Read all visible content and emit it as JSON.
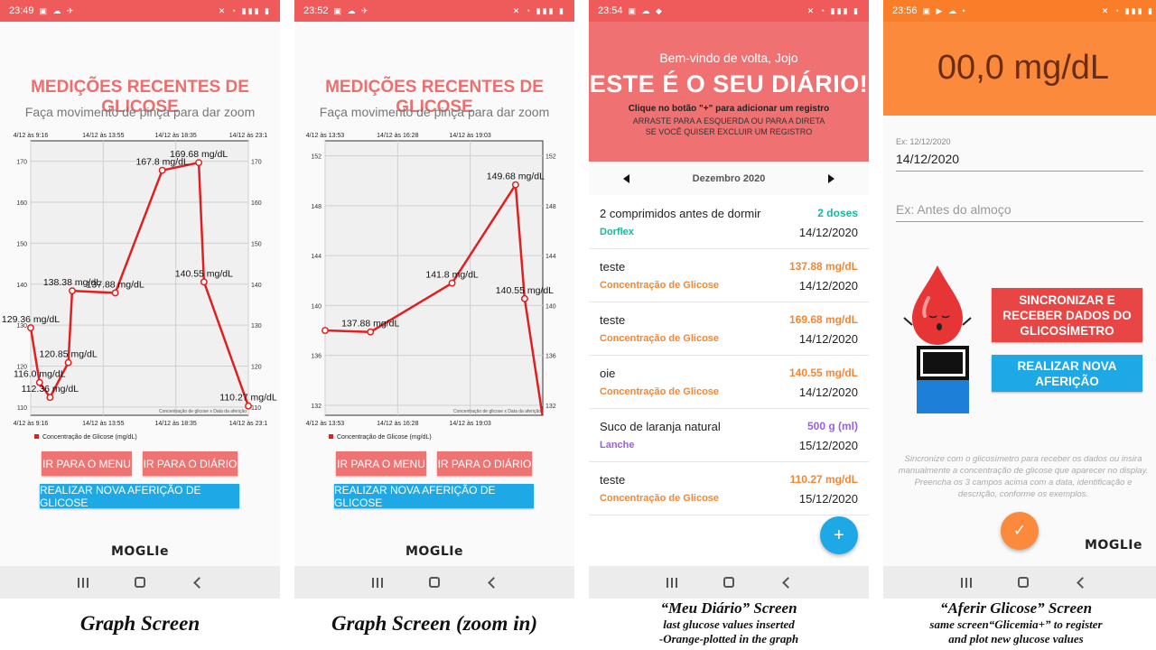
{
  "colors": {
    "red_accent": "#ee6e6e",
    "status_red": "#ef5b5b",
    "status_orange": "#fa7d2a",
    "blue": "#1ea8e6",
    "orange_value": "#f58634",
    "green_dose": "#18b89a",
    "purple": "#9c5fe0"
  },
  "status": {
    "graph1_time": "23:49",
    "graph2_time": "23:52",
    "diary_time": "23:54",
    "aferir_time": "23:56"
  },
  "graph": {
    "title": "MEDIÇÕES RECENTES DE GLICOSE",
    "subtitle": "Faça movimento de pinça para dar zoom",
    "legend": "Concentração de Glicose (mg/dL)",
    "footnote": "Concentração de glicose x Data da aferição",
    "btn_menu": "IR PARA O MENU",
    "btn_diary": "IR PARA O DIÁRIO",
    "btn_new": "REALIZAR NOVA AFERIÇÃO DE GLICOSE",
    "logo": "MOGLIe"
  },
  "chart_data": [
    {
      "type": "line",
      "series": [
        {
          "name": "Concentração de Glicose (mg/dL)",
          "color": "#e02020",
          "points": [
            {
              "x": "14/12 09:16",
              "y": 129.36,
              "label": "129.36 mg/dL"
            },
            {
              "x": "14/12 09:50",
              "y": 116.0,
              "label": "116.0 mg/dL"
            },
            {
              "x": "14/12 10:30",
              "y": 112.36,
              "label": "112.36 mg/dL"
            },
            {
              "x": "14/12 11:40",
              "y": 120.85,
              "label": "120.85 mg/dL"
            },
            {
              "x": "14/12 11:55",
              "y": 138.38,
              "label": "138.38 mg/dL"
            },
            {
              "x": "14/12 14:40",
              "y": 137.88,
              "label": "137.88 mg/dL"
            },
            {
              "x": "14/12 17:40",
              "y": 167.8,
              "label": "167.8 mg/dL"
            },
            {
              "x": "14/12 20:00",
              "y": 169.68,
              "label": "169.68 mg/dL"
            },
            {
              "x": "14/12 20:20",
              "y": 140.55,
              "label": "140.55 mg/dL"
            },
            {
              "x": "14/12 23:10",
              "y": 110.27,
              "label": "110.27 mg/dL"
            }
          ]
        }
      ],
      "x_tick_labels": [
        "4/12 às 9:16",
        "14/12 às 13:55",
        "14/12 às 18:35",
        "14/12 às 23:1"
      ],
      "y_ticks": [
        110,
        120,
        130,
        140,
        150,
        160,
        170
      ],
      "ylim": [
        108,
        175
      ],
      "xlim_minutes": [
        556,
        1390
      ],
      "grid": true,
      "legend_position": "bottom-left"
    },
    {
      "type": "line",
      "series": [
        {
          "name": "Concentração de Glicose (mg/dL)",
          "color": "#e02020",
          "points": [
            {
              "x": "14/12 13:00",
              "y": 138.0,
              "label": ""
            },
            {
              "x": "14/12 14:40",
              "y": 137.88,
              "label": "137.88 mg/dL"
            },
            {
              "x": "14/12 17:40",
              "y": 141.8,
              "label": "141.8 mg/dL"
            },
            {
              "x": "14/12 20:00",
              "y": 149.68,
              "label": "149.68 mg/dL"
            },
            {
              "x": "14/12 20:20",
              "y": 140.55,
              "label": "140.55 mg/dL"
            },
            {
              "x": "14/12 21:00",
              "y": 131.0,
              "label": ""
            }
          ]
        }
      ],
      "x_tick_labels": [
        "4/12 às 13:53",
        "14/12 às 16:28",
        "14/12 às 19:03"
      ],
      "y_ticks": [
        132,
        136,
        140,
        144,
        148,
        152
      ],
      "ylim": [
        131.2,
        153.2
      ],
      "xlim_minutes": [
        780,
        1260
      ],
      "grid": true,
      "legend_position": "bottom-left"
    }
  ],
  "diary": {
    "welcome": "Bem-vindo de volta, Jojo",
    "big_title": "ESTE É O SEU DIÁRIO!",
    "hint": "Clique no botão \"+\" para adicionar um registro",
    "hint2_line1": "ARRASTE PARA A ESQUERDA OU PARA A DIRETA",
    "hint2_line2": "SE VOCÊ QUISER EXCLUIR UM REGISTRO",
    "month": "Dezembro 2020",
    "fab": "+",
    "entries": [
      {
        "title": "2 comprimidos antes de dormir",
        "category": "Dorflex",
        "value": "2 doses",
        "date": "14/12/2020",
        "color": "#18b89a"
      },
      {
        "title": "teste",
        "category": "Concentração de Glicose",
        "value": "137.88 mg/dL",
        "date": "14/12/2020",
        "color": "#f58634"
      },
      {
        "title": "teste",
        "category": "Concentração de Glicose",
        "value": "169.68 mg/dL",
        "date": "14/12/2020",
        "color": "#f58634"
      },
      {
        "title": "oie",
        "category": "Concentração de Glicose",
        "value": "140.55 mg/dL",
        "date": "14/12/2020",
        "color": "#f58634"
      },
      {
        "title": "Suco de laranja natural",
        "category": "Lanche",
        "value": "500 g (ml)",
        "date": "15/12/2020",
        "color": "#9c5fe0"
      },
      {
        "title": "teste",
        "category": "Concentração de Glicose",
        "value": "110.27 mg/dL",
        "date": "15/12/2020",
        "color": "#f58634"
      }
    ]
  },
  "aferir": {
    "value": "00,0 mg/dL",
    "date_hint": "Ex: 12/12/2020",
    "date_value": "14/12/2020",
    "desc_placeholder": "Ex: Antes do almoço",
    "btn_sync": "SINCRONIZAR E RECEBER DADOS DO GLICOSÍMETRO",
    "btn_new": "REALIZAR NOVA AFERIÇÃO",
    "note": "Sincronize com o glicosímetro para receber os dados ou insira manualmente a concentração de glicose que aparecer no display. Preencha os 3 campos acima com a data, identificação e descrição, conforme os exemplos.",
    "logo": "MOGLIe"
  },
  "captions": {
    "graph": "Graph Screen",
    "graph_zoom": "Graph Screen (zoom in)",
    "diary_title": "“Meu Diário” Screen",
    "diary_line1": "last glucose values inserted",
    "diary_line2": "-Orange-plotted in the graph",
    "aferir_title": "“Aferir Glicose” Screen",
    "aferir_line1": "same screen“Glicemia+” to register",
    "aferir_line2": "and plot new glucose values"
  }
}
